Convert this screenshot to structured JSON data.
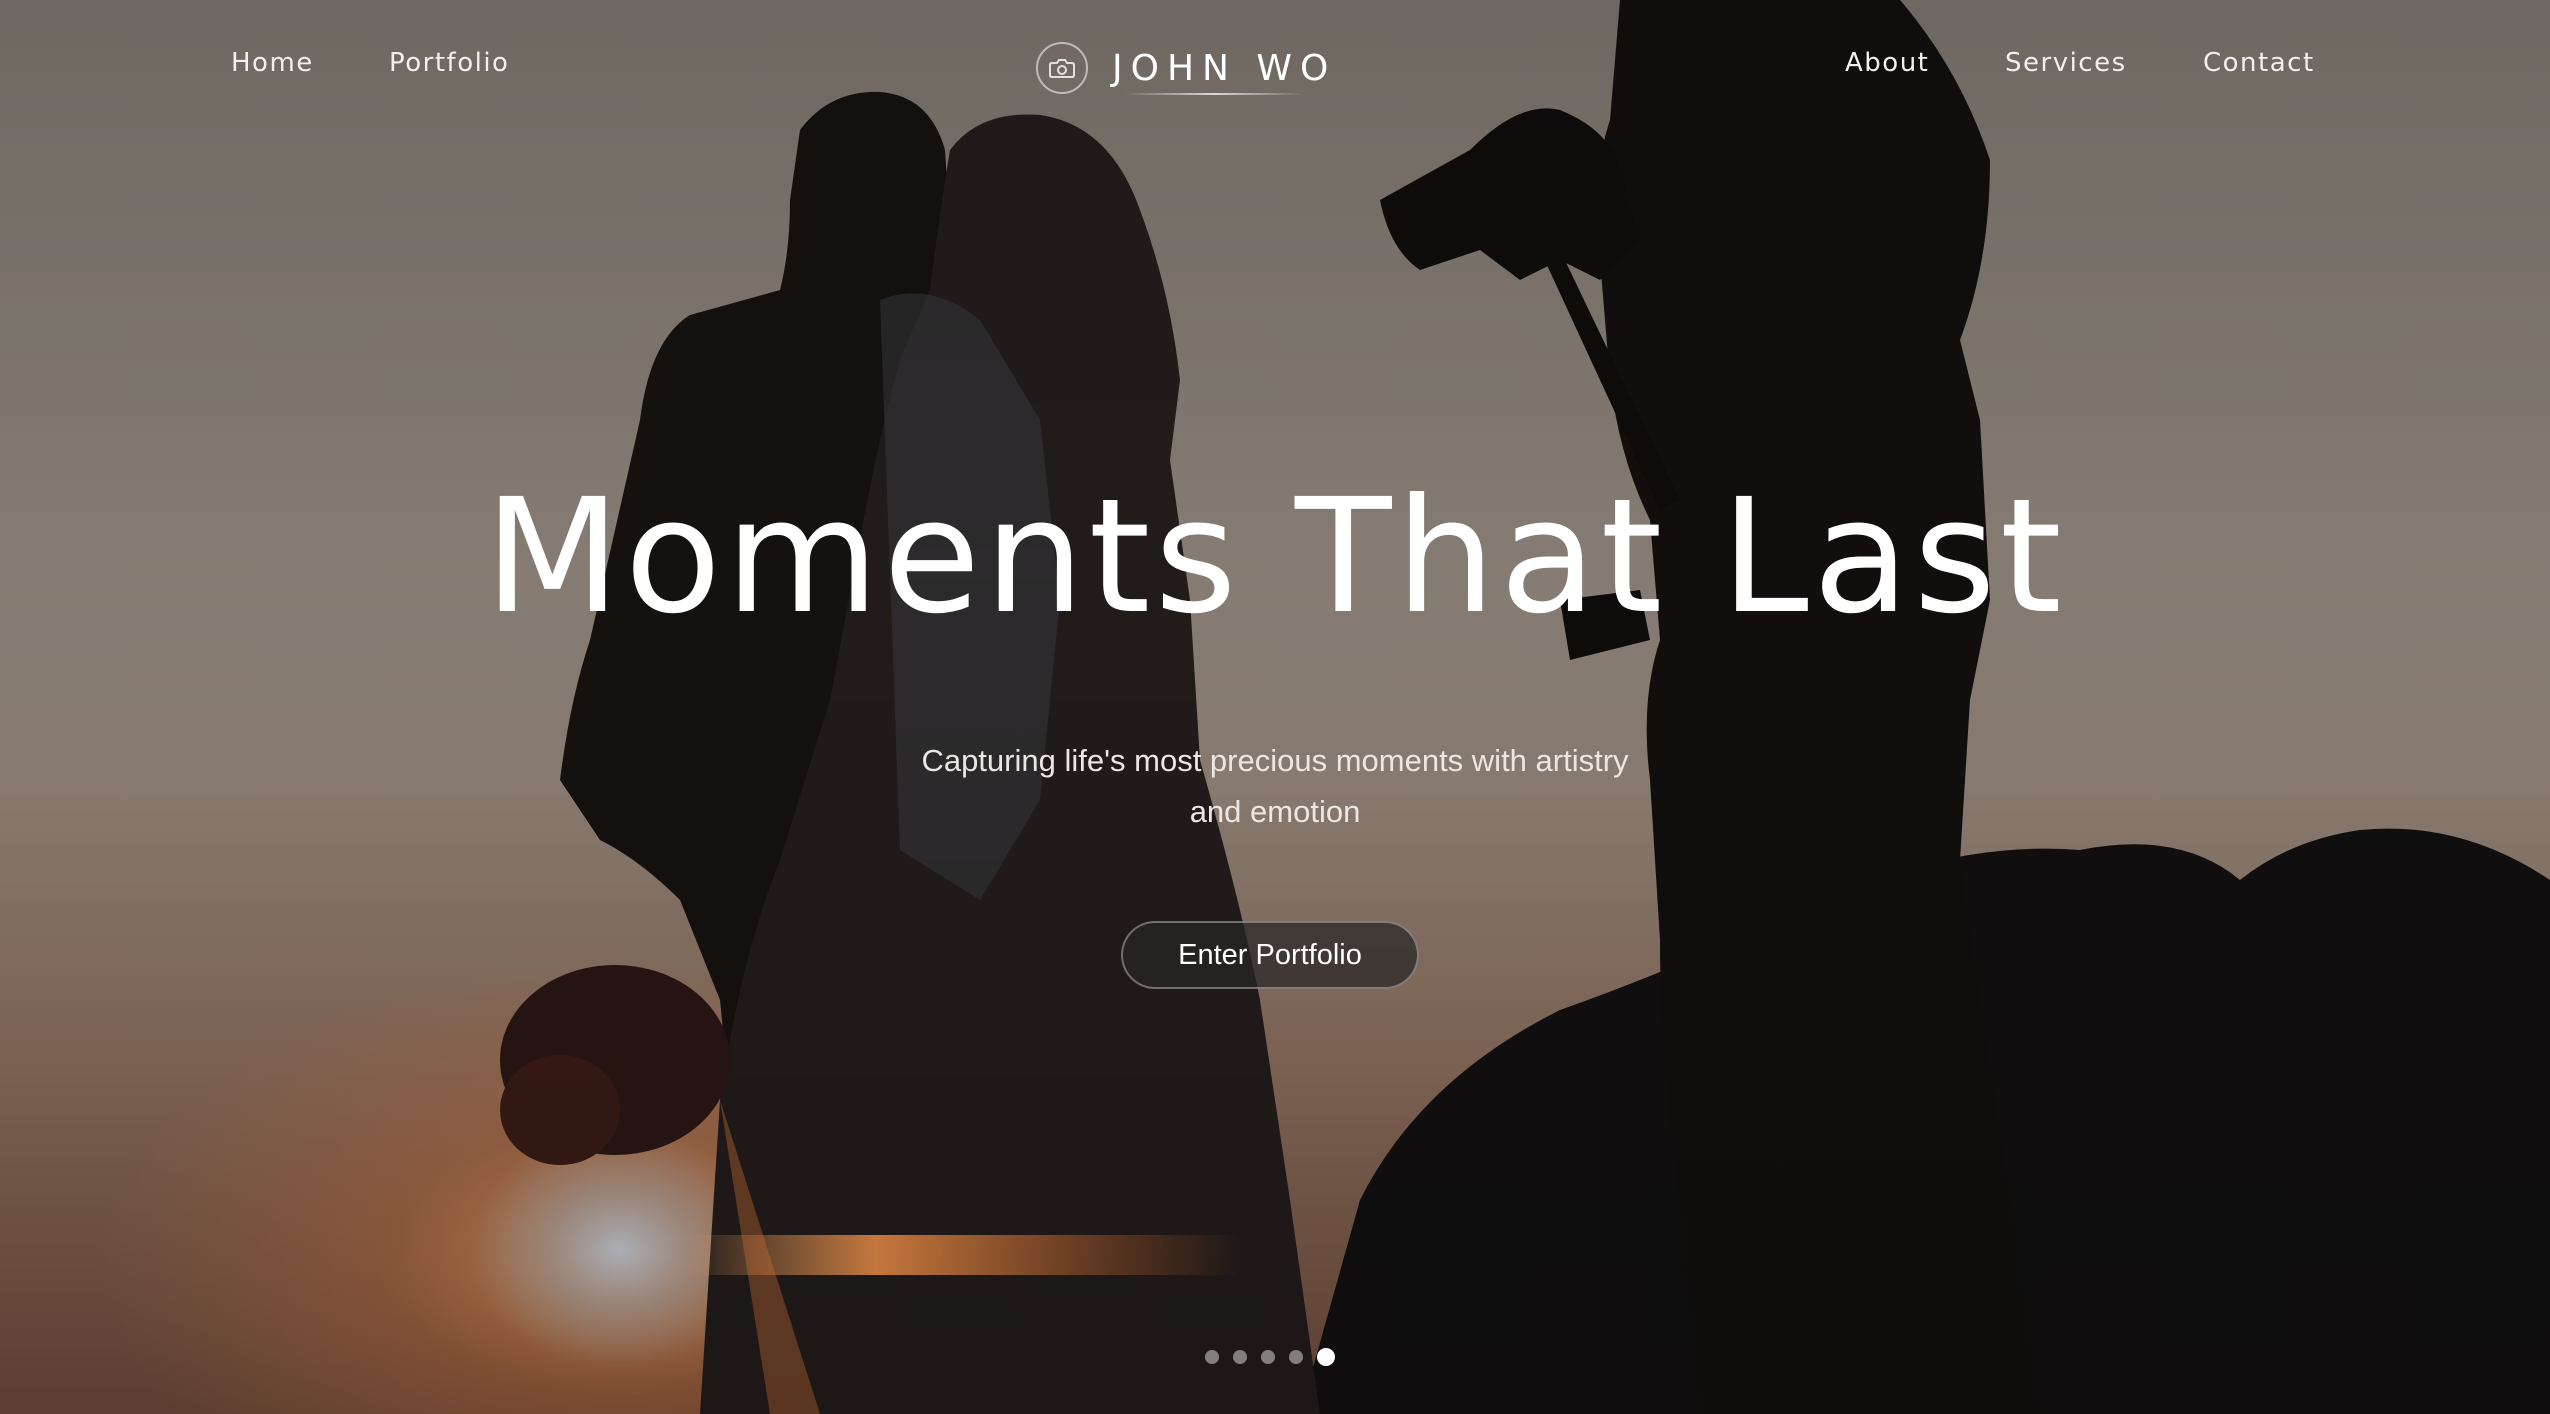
{
  "nav": {
    "left": [
      {
        "label": "Home"
      },
      {
        "label": "Portfolio"
      }
    ],
    "right": [
      {
        "label": "About"
      },
      {
        "label": "Services"
      },
      {
        "label": "Contact"
      }
    ]
  },
  "brand": {
    "name": "JOHN WO",
    "icon": "camera-icon"
  },
  "hero": {
    "title": "Moments That Last",
    "subtitle_line1": "Capturing life's most precious moments with artistry",
    "subtitle_line2": "and emotion",
    "cta_label": "Enter Portfolio",
    "background_image": "silhouette of a wedding couple and a videographer holding a camera against a sunset sky"
  },
  "carousel": {
    "slide_count": 5,
    "active_slide": 5
  },
  "colors": {
    "text": "#ffffff",
    "button_bg": "#2a2828",
    "sunset_glow": "#e8925a"
  }
}
